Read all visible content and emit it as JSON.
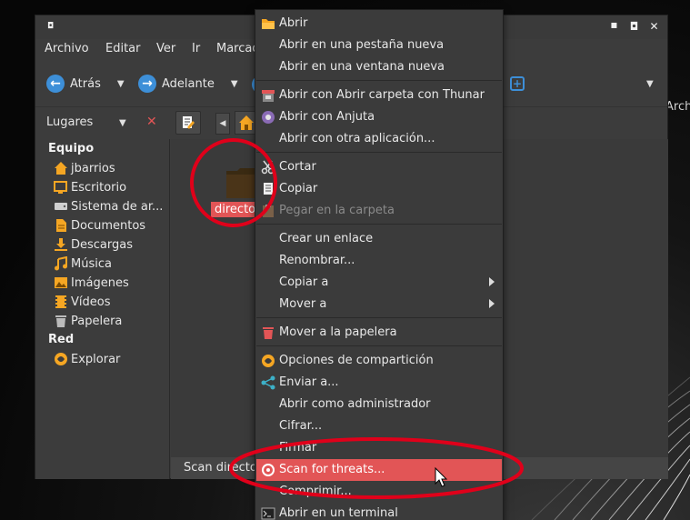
{
  "desktop": {
    "label": "Archo"
  },
  "window": {
    "menu": [
      "Archivo",
      "Editar",
      "Ver",
      "Ir",
      "Marcad"
    ],
    "toolbar": {
      "back": "Atrás",
      "forward": "Adelante"
    },
    "places_label": "Lugares",
    "sidebar": {
      "section_equipo": "Equipo",
      "items": [
        {
          "label": "jbarrios",
          "icon": "home-icon"
        },
        {
          "label": "Escritorio",
          "icon": "desktop-icon"
        },
        {
          "label": "Sistema de ar...",
          "icon": "drive-icon"
        },
        {
          "label": "Documentos",
          "icon": "document-folder-icon"
        },
        {
          "label": "Descargas",
          "icon": "download-icon"
        },
        {
          "label": "Música",
          "icon": "music-icon"
        },
        {
          "label": "Imágenes",
          "icon": "image-icon"
        },
        {
          "label": "Vídeos",
          "icon": "video-icon"
        },
        {
          "label": "Papelera",
          "icon": "trash-icon"
        }
      ],
      "section_red": "Red",
      "network_items": [
        {
          "label": "Explorar",
          "icon": "network-icon"
        }
      ]
    },
    "file": {
      "label": "directo"
    },
    "status": "Scan directo"
  },
  "context_menu": {
    "items": [
      {
        "label": "Abrir",
        "icon": "folder-open-icon"
      },
      {
        "label": "Abrir en una pestaña nueva"
      },
      {
        "label": "Abrir en una ventana nueva"
      },
      {
        "label": "Abrir con Abrir carpeta con Thunar",
        "icon": "thunar-icon"
      },
      {
        "label": "Abrir con Anjuta",
        "icon": "anjuta-icon"
      },
      {
        "label": "Abrir con otra aplicación..."
      },
      {
        "label": "Cortar",
        "icon": "scissors-icon"
      },
      {
        "label": "Copiar",
        "icon": "copy-icon"
      },
      {
        "label": "Pegar en la carpeta",
        "icon": "paste-icon",
        "disabled": true
      },
      {
        "label": "Crear un enlace"
      },
      {
        "label": "Renombrar..."
      },
      {
        "label": "Copiar a",
        "submenu": true
      },
      {
        "label": "Mover a",
        "submenu": true
      },
      {
        "label": "Mover a la papelera",
        "icon": "trash-icon"
      },
      {
        "label": "Opciones de compartición",
        "icon": "share-options-icon"
      },
      {
        "label": "Enviar a...",
        "icon": "share-icon"
      },
      {
        "label": "Abrir como administrador"
      },
      {
        "label": "Cifrar..."
      },
      {
        "label": "Firmar"
      },
      {
        "label": "Scan for threats...",
        "icon": "virus-scan-icon",
        "highlighted": true
      },
      {
        "label": "Comprimir..."
      },
      {
        "label": "Abrir en un terminal",
        "icon": "terminal-icon"
      }
    ]
  },
  "colors": {
    "highlight": "#e25556",
    "annotation": "#e0001a",
    "accent_blue": "#3d8fd8",
    "folder_orange": "#f5a623"
  }
}
